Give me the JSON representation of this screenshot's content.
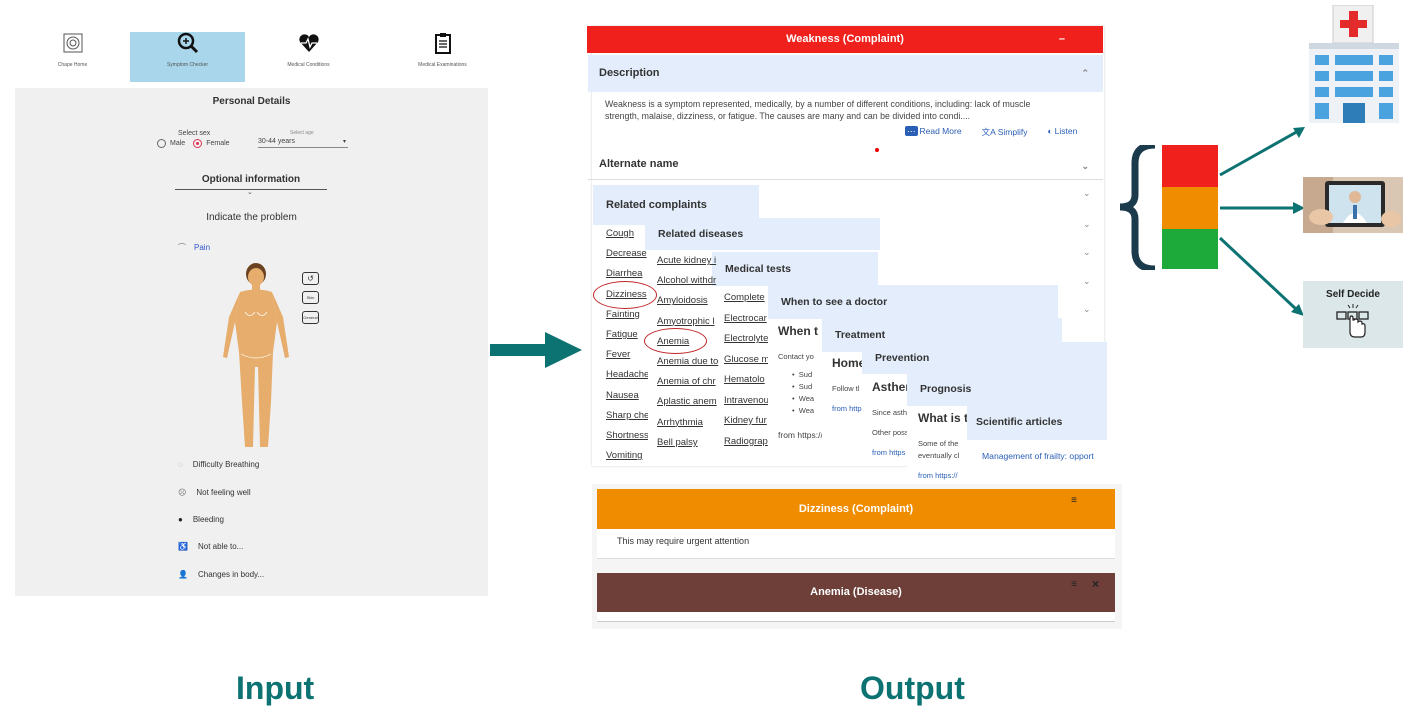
{
  "left_app": {
    "nav": [
      {
        "label": "Chape Home"
      },
      {
        "label": "Symptom Checker"
      },
      {
        "label": "Medical Conditions"
      },
      {
        "label": "Medical Examinations"
      }
    ],
    "personal_details": "Personal Details",
    "select_sex": "Select sex",
    "male": "Male",
    "female": "Female",
    "select_age": "Select age",
    "age_value": "30-44 years",
    "optional_info": "Optional information",
    "indicate": "Indicate the problem",
    "pain": "Pain",
    "body_buttons": [
      "Front",
      "Skin",
      "General"
    ],
    "problems": [
      "Difficulty Breathing",
      "Not feeling well",
      "Bleeding",
      "Not able to...",
      "Changes in body..."
    ]
  },
  "output_app": {
    "header": "Weakness (Complaint)",
    "minimize": "–",
    "description_label": "Description",
    "description_text_1": "Weakness is a symptom represented, medically, by a number of different conditions, including: lack of muscle",
    "description_text_2": "strength, malaise, dizziness, or fatigue. The causes are many and can be divided into condi....",
    "read_more": "Read More",
    "simplify": "Simplify",
    "listen": "Listen",
    "alternate_name": "Alternate name",
    "related_complaints": "Related complaints",
    "complaints": [
      "Cough",
      "Decrease",
      "Diarrhea",
      "Dizziness",
      "Fainting",
      "Fatigue",
      "Fever",
      "Headache",
      "Nausea",
      "Sharp che",
      "Shortness",
      "Vomiting"
    ],
    "related_diseases": "Related diseases",
    "diseases": [
      "Acute kidney i",
      "Alcohol withdr",
      "Amyloidosis",
      "Amyotrophic l",
      "Anemia",
      "Anemia due to",
      "Anemia of chr",
      "Aplastic anem",
      "Arrhythmia",
      "Bell palsy"
    ],
    "medical_tests": "Medical tests",
    "tests": [
      "Complete",
      "Electrocar",
      "Electrolyte",
      "Glucose m",
      "Hematolo",
      "Intravenou",
      "Kidney fur",
      "Radiograp"
    ],
    "when_doctor": "When to see a doctor",
    "when_t": "When t",
    "contact": "Contact yo",
    "bullets": [
      "Sud",
      "Sud",
      "Wea",
      "Wea"
    ],
    "from_medline": "from https://medline",
    "treatment": "Treatment",
    "home": "Home",
    "follow": "Follow tl",
    "from_http": "from http",
    "prevention": "Prevention",
    "asthen": "Asthen",
    "since": "Since asth",
    "other": "Other poss",
    "from_https": "from https",
    "prognosis": "Prognosis",
    "what_is": "What is t",
    "some": "Some of the",
    "eventually": "eventually cl",
    "from_https2": "from https://",
    "scientific": "Scientific articles",
    "article": "Management of frailty: opport",
    "dizziness_header": "Dizziness (Complaint)",
    "dizziness_note": "This may require urgent attention",
    "anemia_header": "Anemia (Disease)",
    "close": "×"
  },
  "right": {
    "self_decide": "Self Decide"
  },
  "labels": {
    "input": "Input",
    "output": "Output"
  },
  "colors": {
    "red": "#f0201c",
    "orange": "#f08c00",
    "brown": "#6d3f38",
    "teal": "#0d7272",
    "panel": "#e3edfb",
    "green": "#1ea93b"
  }
}
